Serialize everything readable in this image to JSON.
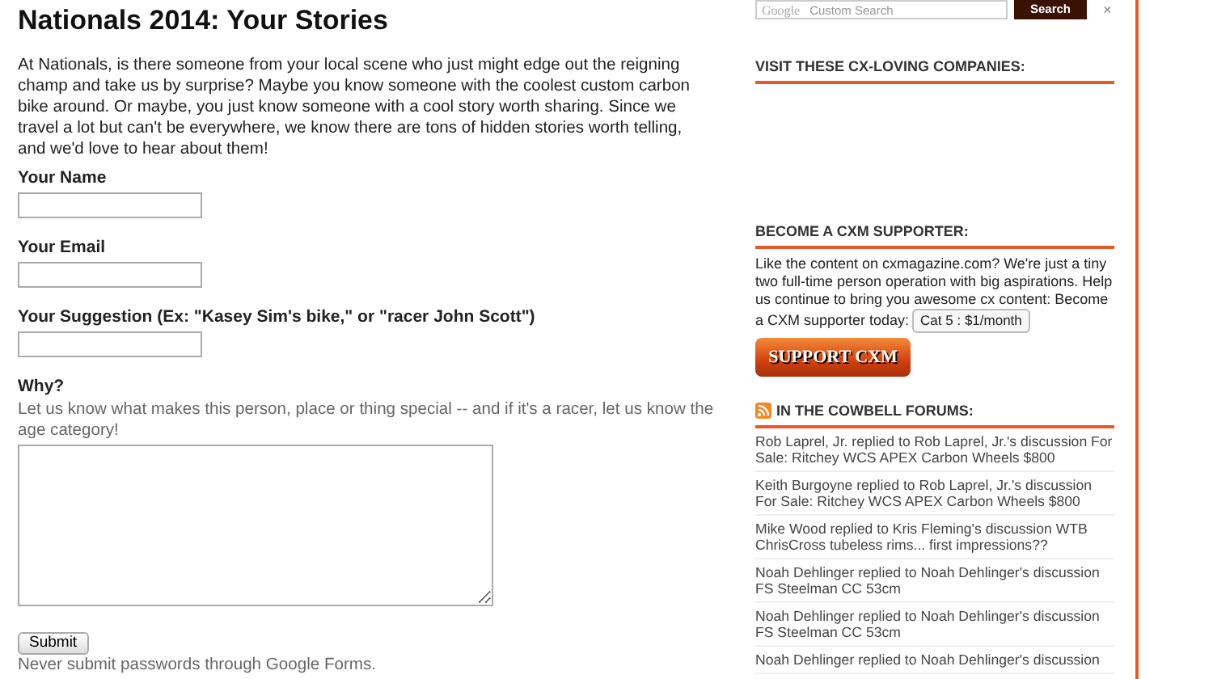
{
  "form": {
    "title": "Nationals 2014: Your Stories",
    "intro": "At Nationals, is there someone from your local scene who just might edge out the reigning champ and take us by surprise? Maybe you know someone with the coolest custom carbon bike around. Or maybe, you just know someone with a cool story worth sharing. Since we travel a lot but can't be everywhere, we know there are tons of hidden stories worth telling, and we'd love to hear about them!",
    "fields": [
      {
        "kind": "text",
        "label": "Your Name"
      },
      {
        "kind": "text",
        "label": "Your Email"
      },
      {
        "kind": "text",
        "label": "Your Suggestion (Ex: \"Kasey Sim's bike,\" or \"racer John Scott\")"
      },
      {
        "kind": "textarea",
        "label": "Why?",
        "help": "Let us know what makes this person, place or thing special -- and if it's a racer, let us know the age category!"
      }
    ],
    "submit": "Submit",
    "note": "Never submit passwords through Google Forms."
  },
  "sidebar": {
    "search": {
      "brand": "Google",
      "placeholder": "Custom Search",
      "button": "Search",
      "clear": "×"
    },
    "sponsors_heading": "VISIT THESE CX-LOVING COMPANIES:",
    "supporter": {
      "heading": "BECOME A CXM SUPPORTER:",
      "text": "Like the content on cxmagazine.com? We're just a tiny two full-time person operation with big aspirations. Help us continue to bring you awesome cx content: Become a CXM supporter today:",
      "select": "Cat 5 : $1/month",
      "button": "SUPPORT CXM"
    },
    "forums": {
      "heading": "IN THE COWBELL FORUMS:",
      "items": [
        "Rob Laprel, Jr. replied to Rob Laprel, Jr.'s discussion For Sale: Ritchey WCS APEX Carbon Wheels $800",
        "Keith Burgoyne replied to Rob Laprel, Jr.'s discussion For Sale: Ritchey WCS APEX Carbon Wheels $800",
        "Mike Wood replied to Kris Fleming's discussion WTB ChrisCross tubeless rims... first impressions??",
        "Noah Dehlinger replied to Noah Dehlinger's discussion FS Steelman CC 53cm",
        "Noah Dehlinger replied to Noah Dehlinger's discussion FS Steelman CC 53cm",
        "Noah Dehlinger replied to Noah Dehlinger's discussion"
      ]
    }
  }
}
